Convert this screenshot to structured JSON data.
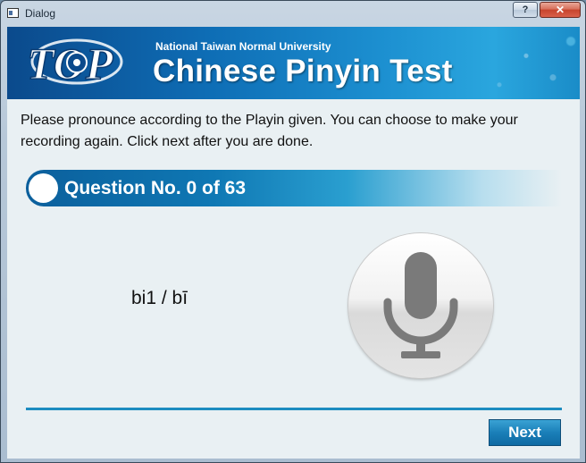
{
  "window": {
    "title": "Dialog",
    "help_label": "?",
    "close_label": "✕"
  },
  "banner": {
    "logo_text": "TOP",
    "subtitle": "National Taiwan Normal University",
    "title": "Chinese Pinyin Test"
  },
  "instructions": "Please pronounce according to the Playin given. You can choose to make your recording again. Click next after you are done.",
  "question": {
    "label": "Question No. 0 of 63"
  },
  "pinyin": "bi1 / bī",
  "buttons": {
    "next": "Next"
  },
  "colors": {
    "accent": "#1c8cc0",
    "banner": "#0e6db5",
    "next_button": "#1a7fb8"
  },
  "icons": [
    "app-icon",
    "help-icon",
    "close-icon",
    "microphone-icon"
  ]
}
